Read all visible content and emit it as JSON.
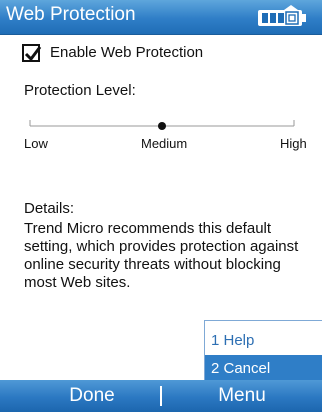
{
  "titlebar": {
    "title": "Web Protection",
    "battery_icon": "battery-icon"
  },
  "enable": {
    "label": "Enable Web Protection",
    "checked": true
  },
  "protection": {
    "label": "Protection Level:",
    "levels": [
      "Low",
      "Medium",
      "High"
    ],
    "selected_level": "Medium",
    "selected_index": 1
  },
  "details": {
    "heading": "Details:",
    "text": "Trend Micro recommends this default setting, which provides protection against online security threats without blocking most Web sites."
  },
  "menu": {
    "items": [
      "1 Help",
      "2 Cancel"
    ],
    "highlighted": "2 Cancel"
  },
  "softkeys": {
    "left": "Done",
    "right": "Menu"
  },
  "colors": {
    "accent": "#2f7ec7",
    "title_text": "#ffffff",
    "menu_link": "#2d6fb3"
  }
}
